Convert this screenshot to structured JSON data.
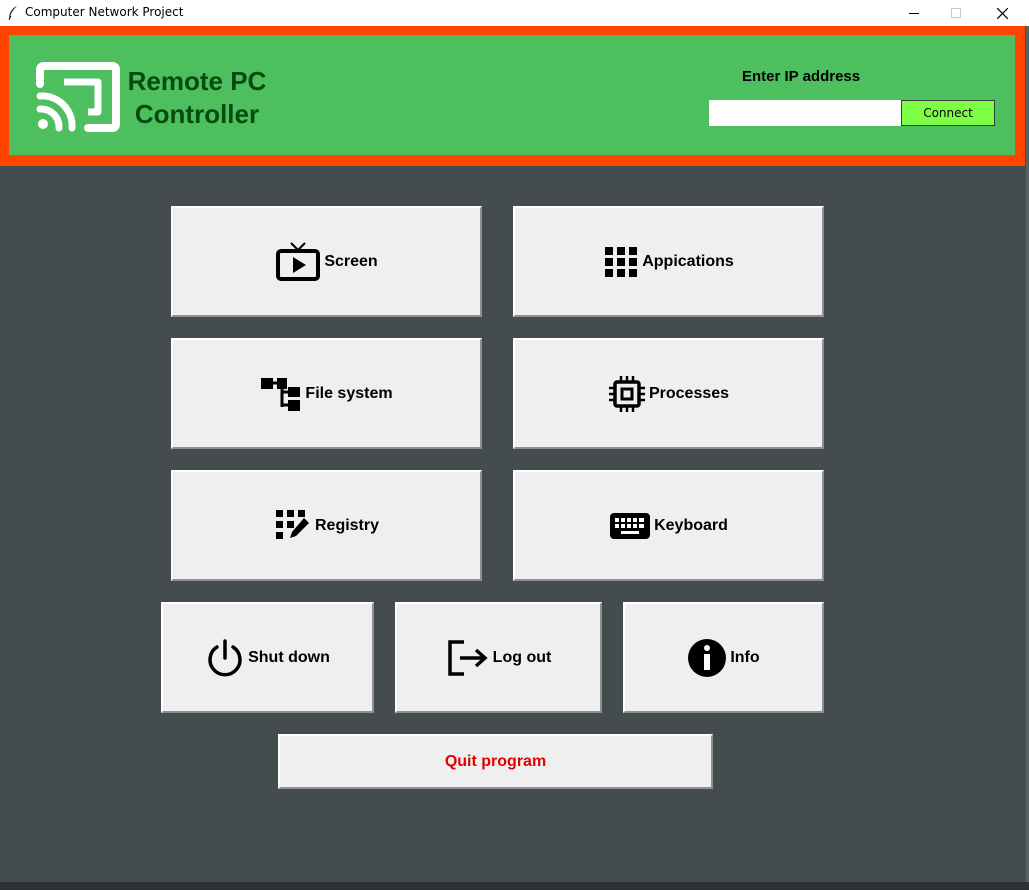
{
  "window": {
    "title": "Computer Network Project",
    "controls": [
      "minimize-icon",
      "maximize-icon",
      "close-icon"
    ]
  },
  "header": {
    "app_name_line1": "Remote PC",
    "app_name_line2": "Controller",
    "ip_label": "Enter IP address",
    "ip_input_value": "",
    "connect_label": "Connect",
    "colors": {
      "border": "#ff4500",
      "background": "#4dbf5f",
      "title": "#064c0f",
      "connect": "#7dff46"
    }
  },
  "buttons": {
    "screen": {
      "label": "Screen",
      "icon": "tv-play-icon"
    },
    "applications": {
      "label": "Appications",
      "icon": "grid-icon"
    },
    "file_system": {
      "label": "File system",
      "icon": "tree-icon"
    },
    "processes": {
      "label": "Processes",
      "icon": "chip-icon"
    },
    "registry": {
      "label": "Registry",
      "icon": "registry-edit-icon"
    },
    "keyboard": {
      "label": "Keyboard",
      "icon": "keyboard-icon"
    },
    "shutdown": {
      "label": "Shut down",
      "icon": "power-icon"
    },
    "logout": {
      "label": "Log out",
      "icon": "logout-icon"
    },
    "info": {
      "label": "Info",
      "icon": "info-icon"
    },
    "quit": {
      "label": "Quit program",
      "color": "#e00000"
    }
  }
}
